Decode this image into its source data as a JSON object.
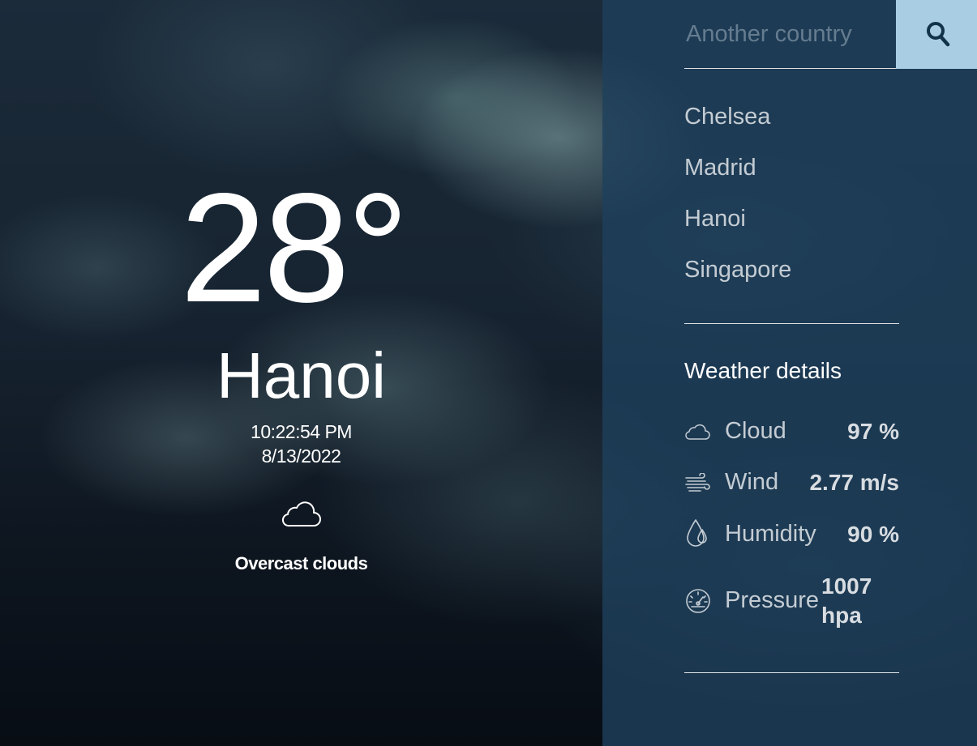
{
  "current": {
    "temperature": "28°",
    "city": "Hanoi",
    "time": "10:22:54 PM",
    "date": "8/13/2022",
    "condition_icon": "cloud-icon",
    "condition": "Overcast clouds"
  },
  "search": {
    "placeholder": "Another country",
    "button_icon": "search-icon"
  },
  "cities": [
    "Chelsea",
    "Madrid",
    "Hanoi",
    "Singapore"
  ],
  "details": {
    "title": "Weather details",
    "items": [
      {
        "label": "Cloud",
        "value": "97 %",
        "icon": "cloud-icon"
      },
      {
        "label": "Wind",
        "value": "2.77 m/s",
        "icon": "wind-icon"
      },
      {
        "label": "Humidity",
        "value": "90 %",
        "icon": "humidity-icon"
      },
      {
        "label": "Pressure",
        "value": "1007 hpa",
        "icon": "pressure-gauge-icon"
      }
    ]
  },
  "colors": {
    "panel": "#1f405c",
    "search_button": "#a9cde3",
    "text_primary": "#ffffff",
    "text_muted": "#c4ccd3"
  }
}
